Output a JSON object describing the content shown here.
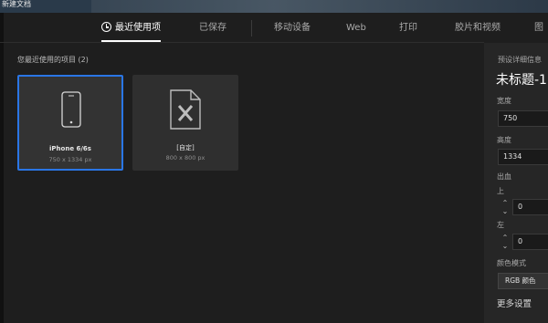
{
  "window": {
    "title": "新建文档"
  },
  "tabs": [
    {
      "label": "最近使用项"
    },
    {
      "label": "已保存"
    },
    {
      "label": "移动设备"
    },
    {
      "label": "Web"
    },
    {
      "label": "打印"
    },
    {
      "label": "胶片和视频"
    },
    {
      "label": "图"
    }
  ],
  "recent": {
    "section_label": "您最近使用的项目",
    "count": "(2)",
    "items": [
      {
        "name": "iPhone 6/6s",
        "size": "750 x 1334 px"
      },
      {
        "name": "[自定]",
        "size": "800 x 800 px"
      }
    ]
  },
  "details": {
    "heading": "预设详细信息",
    "doc_name": "未标题-1",
    "width_label": "宽度",
    "width_value": "750",
    "height_label": "高度",
    "height_value": "1334",
    "bleed_label": "出血",
    "top_label": "上",
    "top_value": "0",
    "left_label": "左",
    "left_value": "0",
    "color_mode_label": "颜色模式",
    "color_mode_value": "RGB 颜色",
    "more_settings": "更多设置"
  },
  "colors": {
    "accent": "#2a76e6",
    "background": "#1e1e1e",
    "panel": "#262626"
  }
}
